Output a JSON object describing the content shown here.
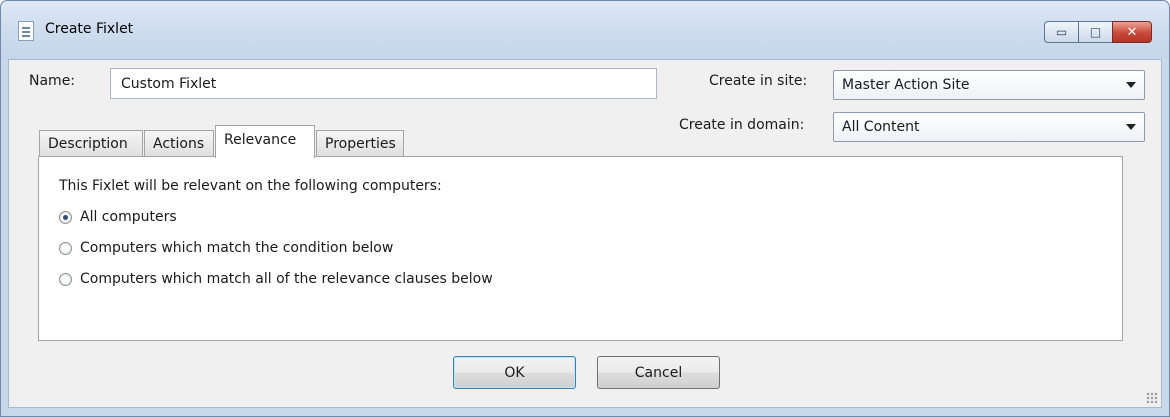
{
  "window": {
    "title": "Create Fixlet",
    "controls": {
      "minimize": "▭",
      "maximize": "□",
      "close": "✕"
    }
  },
  "form": {
    "name_label": "Name:",
    "name_value": "Custom Fixlet",
    "site_label": "Create in site:",
    "site_value": "Master Action Site",
    "domain_label": "Create in domain:",
    "domain_value": "All Content"
  },
  "tabs": [
    {
      "label": "Description",
      "active": false
    },
    {
      "label": "Actions",
      "active": false
    },
    {
      "label": "Relevance",
      "active": true
    },
    {
      "label": "Properties",
      "active": false
    }
  ],
  "relevance": {
    "intro": "This Fixlet will be relevant on the following computers:",
    "options": [
      {
        "label": "All computers",
        "checked": true
      },
      {
        "label": "Computers which match the condition below",
        "checked": false
      },
      {
        "label": "Computers which match all of the relevance clauses below",
        "checked": false
      }
    ]
  },
  "buttons": {
    "ok": "OK",
    "cancel": "Cancel"
  },
  "icons": {
    "title_icon": "document-icon",
    "resize_grip": "resize-grip-icon"
  },
  "colors": {
    "titlebar": "#cfddef",
    "close_button": "#c8483a",
    "client_bg": "#f0f0f0"
  }
}
